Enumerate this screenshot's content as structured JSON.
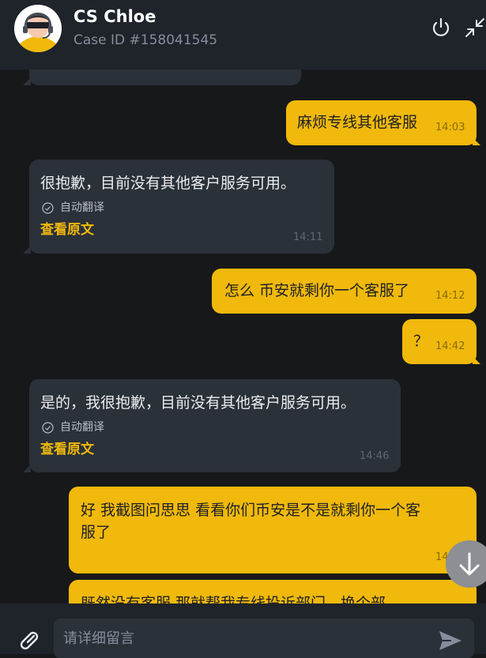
{
  "header": {
    "agent_name": "CS Chloe",
    "case_id": "Case ID #158041545"
  },
  "icons": {
    "power": "power-icon",
    "collapse": "collapse-icon",
    "attach": "link-icon",
    "send": "send-icon",
    "scroll_down": "arrow-down-icon",
    "check": "check-circle-icon"
  },
  "messages": [
    {
      "side": "out",
      "text": "麻烦专线其他客服",
      "time": "14:03"
    },
    {
      "side": "in",
      "text": "很抱歉，目前没有其他客户服务可用。",
      "translated": "自动翻译",
      "view_original": "查看原文",
      "time": "14:11"
    },
    {
      "side": "out",
      "text": "怎么  币安就剩你一个客服了",
      "time": "14:12"
    },
    {
      "side": "out",
      "text": "？",
      "time": "14:42"
    },
    {
      "side": "in",
      "text": "是的，我很抱歉，目前没有其他客户服务可用。",
      "translated": "自动翻译",
      "view_original": "查看原文",
      "time": "14:46"
    },
    {
      "side": "out",
      "text_line1": "好  我截图问思思  看看你们币安是不是就剩你一个客",
      "text_line2": "服了",
      "time": "14:4"
    },
    {
      "side": "out",
      "text": "既然没有客服 那就帮我专线投诉部门，换个部"
    }
  ],
  "composer": {
    "placeholder": "请详细留言"
  },
  "colors": {
    "accent": "#f0b90b",
    "incoming_bubble": "#2b3139",
    "background": "#17181a",
    "header": "#1f232a"
  }
}
